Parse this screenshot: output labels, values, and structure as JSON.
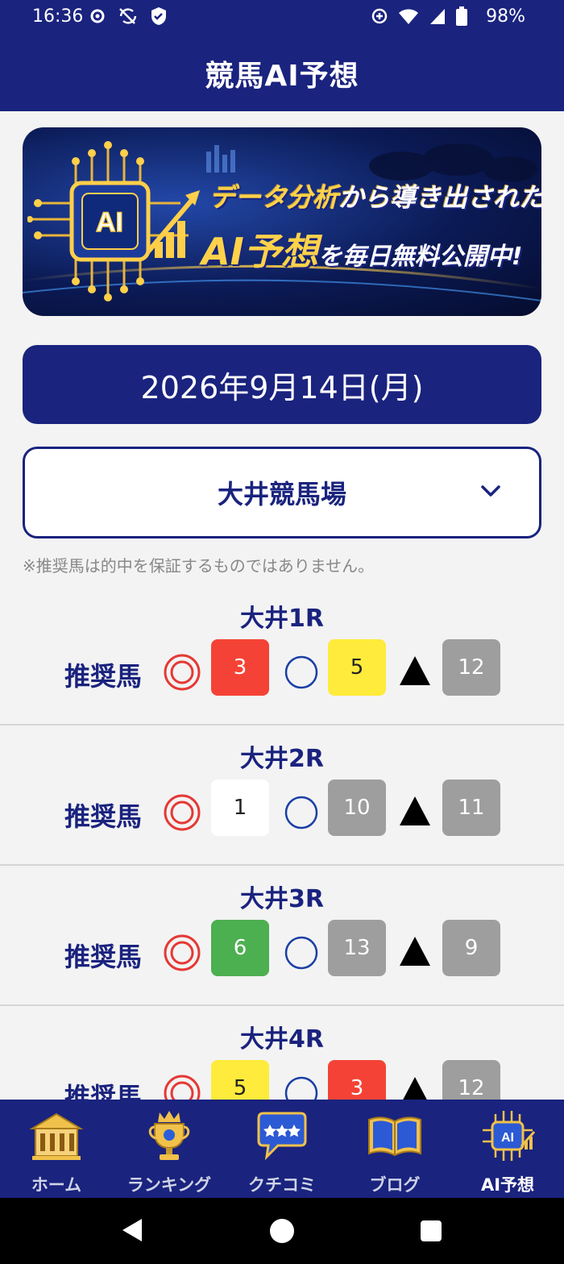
{
  "status_bar": {
    "time": "16:36",
    "battery": "98%"
  },
  "app_bar": {
    "title": "競馬AI予想"
  },
  "banner": {
    "line1_highlight": "データ分析",
    "line1_rest": "から導き出された",
    "line2_highlight": "AI予想",
    "line2_rest": "を毎日無料公開中!",
    "chip_label": "AI"
  },
  "date_bar": {
    "text": "2026年9月14日(月)"
  },
  "venue": {
    "selected": "大井競馬場"
  },
  "disclaimer": "※推奨馬は的中を保証するものではありません。",
  "recommend_label": "推奨馬",
  "races": [
    {
      "title": "大井1R",
      "picks": [
        {
          "num": "3",
          "color": "#f44336",
          "text": "#ffffff"
        },
        {
          "num": "5",
          "color": "#ffeb3b",
          "text": "#222222"
        },
        {
          "num": "12",
          "color": "#9e9e9e",
          "text": "#ffffff"
        }
      ]
    },
    {
      "title": "大井2R",
      "picks": [
        {
          "num": "1",
          "color": "#ffffff",
          "text": "#222222"
        },
        {
          "num": "10",
          "color": "#9e9e9e",
          "text": "#ffffff"
        },
        {
          "num": "11",
          "color": "#9e9e9e",
          "text": "#ffffff"
        }
      ]
    },
    {
      "title": "大井3R",
      "picks": [
        {
          "num": "6",
          "color": "#4caf50",
          "text": "#ffffff"
        },
        {
          "num": "13",
          "color": "#9e9e9e",
          "text": "#ffffff"
        },
        {
          "num": "9",
          "color": "#9e9e9e",
          "text": "#ffffff"
        }
      ]
    },
    {
      "title": "大井4R",
      "picks": [
        {
          "num": "5",
          "color": "#ffeb3b",
          "text": "#222222"
        },
        {
          "num": "3",
          "color": "#f44336",
          "text": "#ffffff"
        },
        {
          "num": "12",
          "color": "#9e9e9e",
          "text": "#ffffff"
        }
      ]
    }
  ],
  "bottom_nav": [
    {
      "label": "ホーム",
      "icon": "home-building-icon",
      "active": false
    },
    {
      "label": "ランキング",
      "icon": "trophy-icon",
      "active": false
    },
    {
      "label": "クチコミ",
      "icon": "review-bubble-icon",
      "active": false
    },
    {
      "label": "ブログ",
      "icon": "book-icon",
      "active": false
    },
    {
      "label": "AI予想",
      "icon": "ai-chip-icon",
      "active": true
    }
  ],
  "colors": {
    "primary": "#1a237e",
    "honmei": "#e53935",
    "taikou": "#1a3fa6"
  }
}
